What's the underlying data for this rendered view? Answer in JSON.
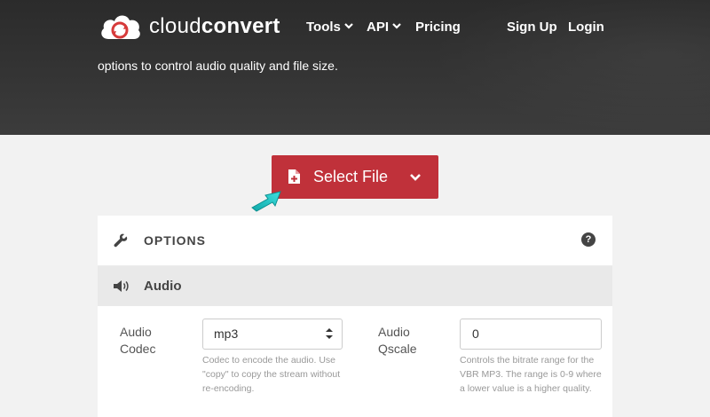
{
  "header": {
    "brand_light": "cloud",
    "brand_bold": "convert",
    "nav": {
      "tools": "Tools",
      "api": "API",
      "pricing": "Pricing",
      "signup": "Sign Up",
      "login": "Login"
    },
    "subtitle": "options to control audio quality and file size."
  },
  "upload": {
    "select_file_label": "Select File",
    "icon": "file-plus-icon",
    "dropdown_icon": "chevron-down-icon",
    "accent_color": "#c0313a"
  },
  "options": {
    "title": "OPTIONS",
    "help_glyph": "?",
    "section": {
      "title": "Audio",
      "fields": [
        {
          "label_line1": "Audio",
          "label_line2": "Codec",
          "value": "mp3",
          "help": "Codec to encode the audio. Use \"copy\" to copy the stream without re-encoding."
        },
        {
          "label_line1": "Audio",
          "label_line2": "Qscale",
          "value": "0",
          "help": "Controls the bitrate range for the VBR MP3. The range is 0-9 where a lower value is a higher quality."
        }
      ]
    }
  },
  "colors": {
    "header_bg": "#2f2f2f",
    "pointer_arrow": "#1ec6c6"
  }
}
